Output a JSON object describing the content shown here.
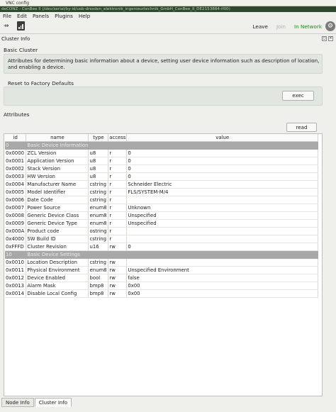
{
  "vnc": {
    "title": "VNC config"
  },
  "window": {
    "title": "deCONZ - ConBee II (/dev/serial/by-id/usb-dresden_elektronik_ingenieurtechnik_GmbH_ConBee_II_DE2153884-if00)"
  },
  "menu": {
    "items": [
      "File",
      "Edit",
      "Panels",
      "Plugins",
      "Help"
    ]
  },
  "toolbar": {
    "leave": "Leave",
    "join": "Join",
    "status": "In Network",
    "status_color": "#1c8c1c"
  },
  "dock": {
    "title": "Cluster Info"
  },
  "basic_cluster": {
    "title": "Basic Cluster",
    "description": "Attributes for determining basic information about a device, setting user device information such as description of location, and enabling a device."
  },
  "reset": {
    "title": "Reset to Factory Defaults",
    "exec_label": "exec"
  },
  "attributes": {
    "title": "Attributes",
    "read_label": "read",
    "columns": [
      "id",
      "name",
      "type",
      "access",
      "value"
    ],
    "rows": [
      {
        "group": true,
        "id": "0",
        "name": "Basic Device Information"
      },
      {
        "id": "0x0000",
        "name": "ZCL Version",
        "type": "u8",
        "access": "r",
        "value": "0"
      },
      {
        "id": "0x0001",
        "name": "Application Version",
        "type": "u8",
        "access": "r",
        "value": "0"
      },
      {
        "id": "0x0002",
        "name": "Stack Version",
        "type": "u8",
        "access": "r",
        "value": "0"
      },
      {
        "id": "0x0003",
        "name": "HW Version",
        "type": "u8",
        "access": "r",
        "value": "0"
      },
      {
        "id": "0x0004",
        "name": "Manufacturer Name",
        "type": "cstring",
        "access": "r",
        "value": "Schneider Electric"
      },
      {
        "id": "0x0005",
        "name": "Model Identifier",
        "type": "cstring",
        "access": "r",
        "value": "FLS/SYSTEM-M/4"
      },
      {
        "id": "0x0006",
        "name": "Date Code",
        "type": "cstring",
        "access": "r",
        "value": ""
      },
      {
        "id": "0x0007",
        "name": "Power Source",
        "type": "enum8",
        "access": "r",
        "value": "Unknown"
      },
      {
        "id": "0x0008",
        "name": "Generic Device Class",
        "type": "enum8",
        "access": "r",
        "value": "Unspecified"
      },
      {
        "id": "0x0009",
        "name": "Generic Device Type",
        "type": "enum8",
        "access": "r",
        "value": "Unspecified"
      },
      {
        "id": "0x000A",
        "name": "Product code",
        "type": "ostring",
        "access": "r",
        "value": ""
      },
      {
        "id": "0x4000",
        "name": "SW Build ID",
        "type": "cstring",
        "access": "r",
        "value": ""
      },
      {
        "id": "0xFFFD",
        "name": "Cluster Revision",
        "type": "u16",
        "access": "rw",
        "value": "0"
      },
      {
        "group": true,
        "id": "10",
        "name": "Basic Device Settings"
      },
      {
        "id": "0x0010",
        "name": "Location Description",
        "type": "cstring",
        "access": "rw",
        "value": ""
      },
      {
        "id": "0x0011",
        "name": "Physical Environment",
        "type": "enum8",
        "access": "rw",
        "value": "Unspecified Environment"
      },
      {
        "id": "0x0012",
        "name": "Device Enabled",
        "type": "bool",
        "access": "rw",
        "value": "false"
      },
      {
        "id": "0x0013",
        "name": "Alarm Mask",
        "type": "bmp8",
        "access": "rw",
        "value": "0x00"
      },
      {
        "id": "0x0014",
        "name": "Disable Local Config",
        "type": "bmp8",
        "access": "rw",
        "value": "0x00"
      }
    ]
  },
  "tabs": [
    {
      "label": "Node Info",
      "active": false
    },
    {
      "label": "Cluster Info",
      "active": true
    }
  ]
}
